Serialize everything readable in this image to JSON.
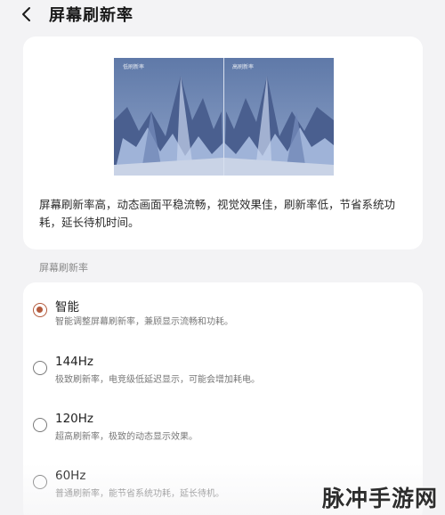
{
  "header": {
    "back_icon": "chevron-left-icon",
    "title": "屏幕刷新率"
  },
  "preview": {
    "left_tag": "低刷新率",
    "right_tag": "高刷新率",
    "description": "屏幕刷新率高，动态画面平稳流畅，视觉效果佳，刷新率低，节省系统功耗，延长待机时间。"
  },
  "section_label": "屏幕刷新率",
  "options": [
    {
      "label": "智能",
      "desc": "智能调整屏幕刷新率，兼顾显示流畅和功耗。",
      "selected": true
    },
    {
      "label": "144Hz",
      "desc": "极致刷新率，电竞级低延迟显示，可能会增加耗电。",
      "selected": false
    },
    {
      "label": "120Hz",
      "desc": "超高刷新率，极致的动态显示效果。",
      "selected": false
    },
    {
      "label": "60Hz",
      "desc": "普通刷新率，能节省系统功耗，延长待机。",
      "selected": false
    }
  ],
  "colors": {
    "accent": "#b35a3c",
    "background": "#f3f3f5",
    "card": "#ffffff"
  },
  "watermark": "脉冲手游网"
}
